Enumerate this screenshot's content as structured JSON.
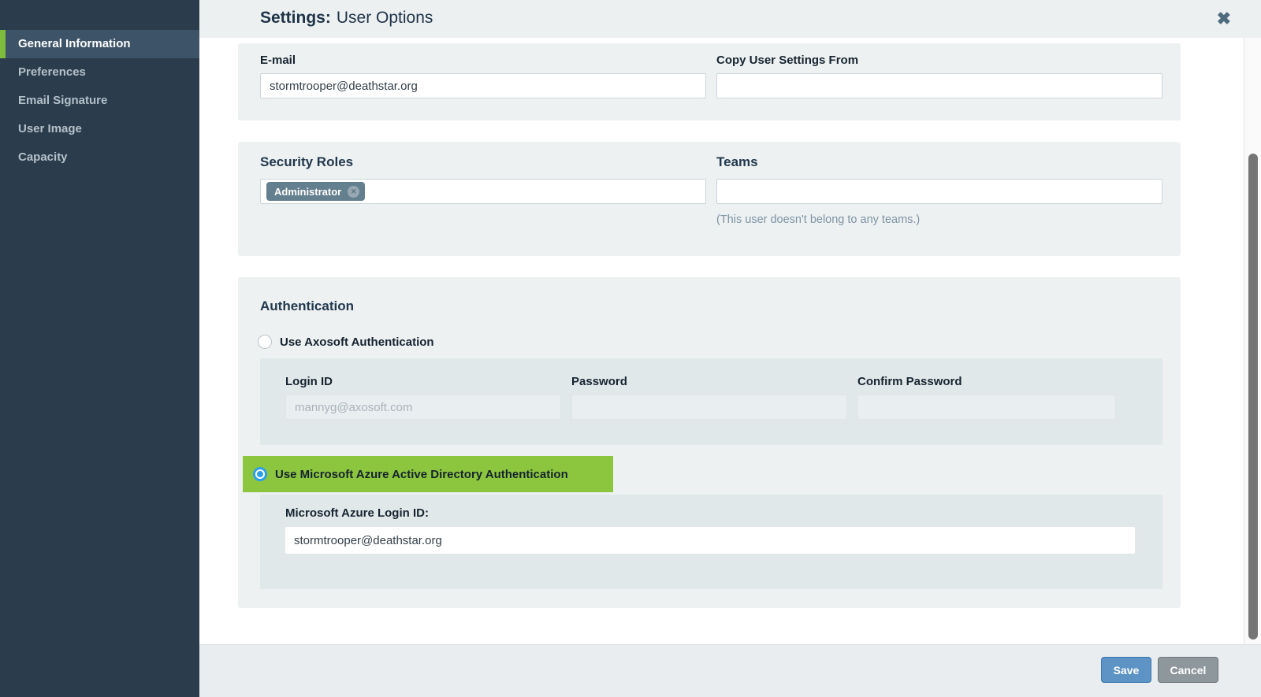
{
  "header": {
    "title_prefix": "Settings:",
    "title": "User Options"
  },
  "icons": {
    "close": "✖",
    "tag_remove": "✕"
  },
  "sidebar": {
    "items": [
      {
        "label": "General Information",
        "active": true
      },
      {
        "label": "Preferences",
        "active": false
      },
      {
        "label": "Email Signature",
        "active": false
      },
      {
        "label": "User Image",
        "active": false
      },
      {
        "label": "Capacity",
        "active": false
      }
    ]
  },
  "general": {
    "email_label": "E-mail",
    "email_value": "stormtrooper@deathstar.org",
    "copy_label": "Copy User Settings From",
    "copy_value": ""
  },
  "roles_teams": {
    "roles_label": "Security Roles",
    "roles": [
      {
        "name": "Administrator"
      }
    ],
    "teams_label": "Teams",
    "teams_value": "",
    "teams_note": "(This user doesn't belong to any teams.)"
  },
  "auth": {
    "title": "Authentication",
    "axosoft_label": "Use Axosoft Authentication",
    "axosoft_selected": false,
    "login_id_label": "Login ID",
    "login_id_placeholder": "mannyg@axosoft.com",
    "login_id_value": "",
    "password_label": "Password",
    "password_value": "",
    "confirm_label": "Confirm Password",
    "confirm_value": "",
    "azure_label": "Use Microsoft Azure Active Directory Authentication",
    "azure_selected": true,
    "azure_login_label": "Microsoft Azure Login ID:",
    "azure_login_value": "stormtrooper@deathstar.org"
  },
  "footer": {
    "save_label": "Save",
    "cancel_label": "Cancel"
  },
  "colors": {
    "highlight_green": "#8cc63e",
    "radio_selected_blue": "#2ba0e8",
    "save_button_blue": "#5e93c6",
    "cancel_button_gray": "#8e979c",
    "sidebar_bg": "#2b3c4c",
    "active_item_bar_green": "#7fbb3d"
  }
}
